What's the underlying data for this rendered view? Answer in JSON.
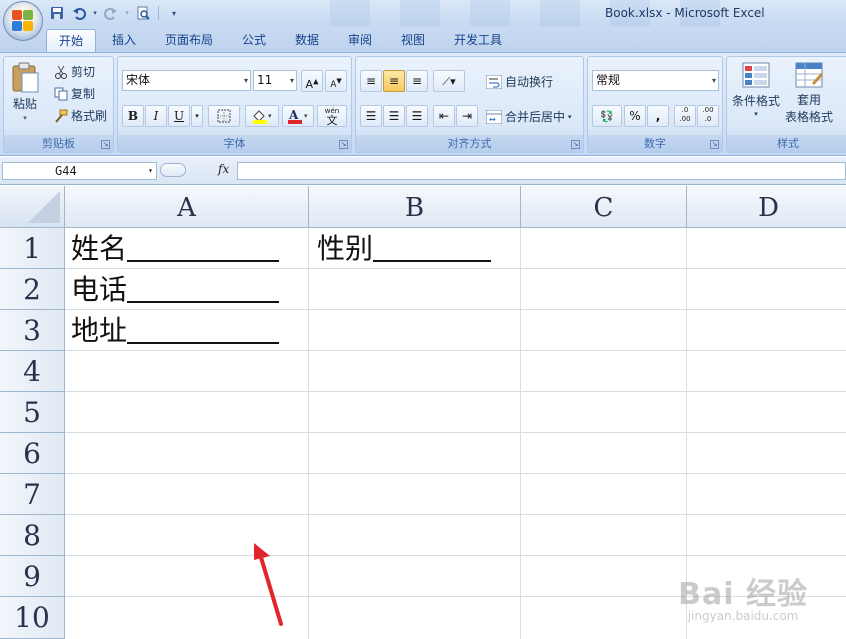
{
  "window": {
    "title": "Book.xlsx - Microsoft Excel"
  },
  "tabs": [
    "开始",
    "插入",
    "页面布局",
    "公式",
    "数据",
    "审阅",
    "视图",
    "开发工具"
  ],
  "ribbon": {
    "clipboard": {
      "label": "剪贴板",
      "paste": "粘贴",
      "cut": "剪切",
      "copy": "复制",
      "format_painter": "格式刷"
    },
    "font": {
      "label": "字体",
      "font_name": "宋体",
      "font_size": "11",
      "bold": "B",
      "italic": "I",
      "underline": "U"
    },
    "alignment": {
      "label": "对齐方式",
      "wrap_text": "自动换行",
      "merge_center": "合并后居中"
    },
    "number": {
      "label": "数字",
      "format": "常规",
      "percent": "%",
      "comma": ",",
      "inc_decimal": ".0\n.00",
      "dec_decimal": ".00\n.0"
    },
    "styles": {
      "label": "样式",
      "conditional_format": "条件格式",
      "table_format_1": "套用",
      "table_format_2": "表格格式"
    },
    "wen_glyph": "wén",
    "wen_char": "文"
  },
  "formula_bar": {
    "name_box": "G44",
    "fx": "fx",
    "formula": ""
  },
  "grid": {
    "columns": [
      "A",
      "B",
      "C",
      "D"
    ],
    "rows": [
      "1",
      "2",
      "3",
      "4",
      "5",
      "6",
      "7",
      "8",
      "9",
      "10"
    ],
    "cells": {
      "A1": "姓名",
      "B1": "性别",
      "A2": "电话",
      "A3": "地址"
    }
  },
  "watermark": {
    "line1": "Bai 经验",
    "line2": "jingyan.baidu.com"
  },
  "colors": {
    "accent": "#15428b",
    "arrow": "#e0262b"
  }
}
